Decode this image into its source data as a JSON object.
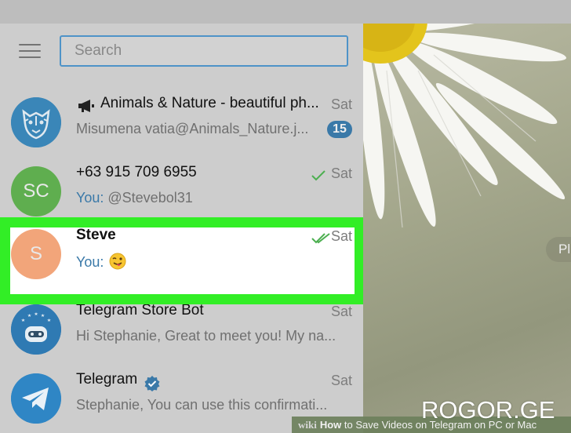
{
  "search": {
    "placeholder": "Search"
  },
  "chats": [
    {
      "name": "Animals & Nature - beautiful ph...",
      "time": "Sat",
      "preview": "Misumena vatia@Animals_Nature.j...",
      "unread": "15"
    },
    {
      "name": "+63 915 709 6955",
      "time": "Sat",
      "initials": "SC",
      "you_label": "You:",
      "preview": " @Stevebol31",
      "status": "sent"
    },
    {
      "name": "Steve",
      "time": "Sat",
      "initials": "S",
      "you_label": "You:",
      "status": "read",
      "selected": true
    },
    {
      "name": "Telegram Store Bot",
      "time": "Sat",
      "preview": "Hi Stephanie, Great to meet you! My na..."
    },
    {
      "name": "Telegram",
      "time": "Sat",
      "preview": "Stephanie,  You can use this confirmati...",
      "verified": true
    }
  ],
  "right_panel": {
    "pill_text": "Pl"
  },
  "footer": {
    "wiki": "wiki",
    "how": "How",
    "rest": " to Save Videos on Telegram on PC or Mac"
  },
  "watermark": "ROGOR.GE",
  "colors": {
    "accent": "#3a79a8",
    "highlight": "#32ee26",
    "avatar_sc": "#5fae4f",
    "avatar_s": "#f2a57a",
    "check": "#4caf50"
  }
}
